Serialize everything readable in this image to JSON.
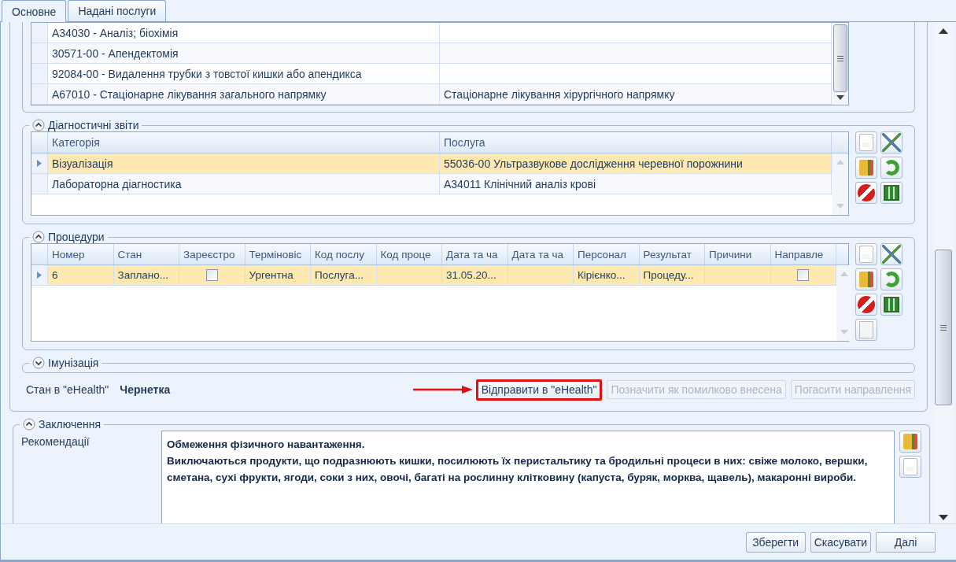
{
  "tabs": [
    {
      "label": "Основне",
      "selected": true
    },
    {
      "label": "Надані послуги",
      "selected": false
    }
  ],
  "services_table": {
    "rows": [
      {
        "service": "A34030 - Аналіз; біохімія",
        "direction": ""
      },
      {
        "service": "30571-00 - Апендектомія",
        "direction": ""
      },
      {
        "service": "92084-00 - Видалення трубки з товстої кишки або апендикса",
        "direction": ""
      },
      {
        "service": "A67010 - Стаціонарне лікування загального напрямку",
        "direction": "Стаціонарне лікування хірургічного напрямку"
      }
    ]
  },
  "diagnostic_reports": {
    "title": "Діагностичні звіти",
    "expanded": true,
    "columns": [
      "Категорія",
      "Послуга"
    ],
    "rows": [
      {
        "category": "Візуалізація",
        "service": "55036-00 Ультразвукове дослідження черевної порожнини",
        "selected": true
      },
      {
        "category": "Лабораторна діагностика",
        "service": "A34011 Клінічний аналіз крові",
        "selected": false
      }
    ]
  },
  "procedures": {
    "title": "Процедури",
    "expanded": true,
    "columns": [
      "Номер",
      "Стан",
      "Зареєстро",
      "Терміновіс",
      "Код послу",
      "Код проце",
      "Дата та ча",
      "Дата та ча",
      "Персонал",
      "Результат",
      "Причини",
      "Направле"
    ],
    "rows": [
      {
        "number": "6",
        "status": "Заплано...",
        "registered": false,
        "urgency": "Ургентна",
        "service_code": "Послуга...",
        "procedure_code": "",
        "start": "31.05.20...",
        "end": "",
        "staff": "Кірієнко...",
        "result": "Процеду...",
        "reasons": "",
        "referral": false,
        "selected": true
      }
    ]
  },
  "immunization": {
    "title": "Імунізація",
    "expanded": false
  },
  "ehealth": {
    "label": "Стан в \"eHealth\"",
    "status": "Чернетка",
    "buttons": [
      {
        "label": "Відправити в \"eHealth\"",
        "disabled": false,
        "highlighted": true
      },
      {
        "label": "Позначити як помилково внесена",
        "disabled": true,
        "highlighted": false
      },
      {
        "label": "Погасити направлення",
        "disabled": true,
        "highlighted": false
      }
    ]
  },
  "conclusion": {
    "title": "Заключення",
    "expanded": true,
    "field_label": "Рекомендації",
    "text": [
      "Обмеження фізичного навантаження.",
      "Виключаються продукти, що подразнюють кишки, посилюють їх перистальтику та бродильні процеси в них: свіже молоко, вершки, сметана, сухі фрукти, ягоди, соки з них, овочі, багаті на рослинну клітковину (капуста, буряк, морква, щавель), макаронні вироби."
    ]
  },
  "footer_buttons": [
    "Зберегти",
    "Скасувати",
    "Далі"
  ]
}
